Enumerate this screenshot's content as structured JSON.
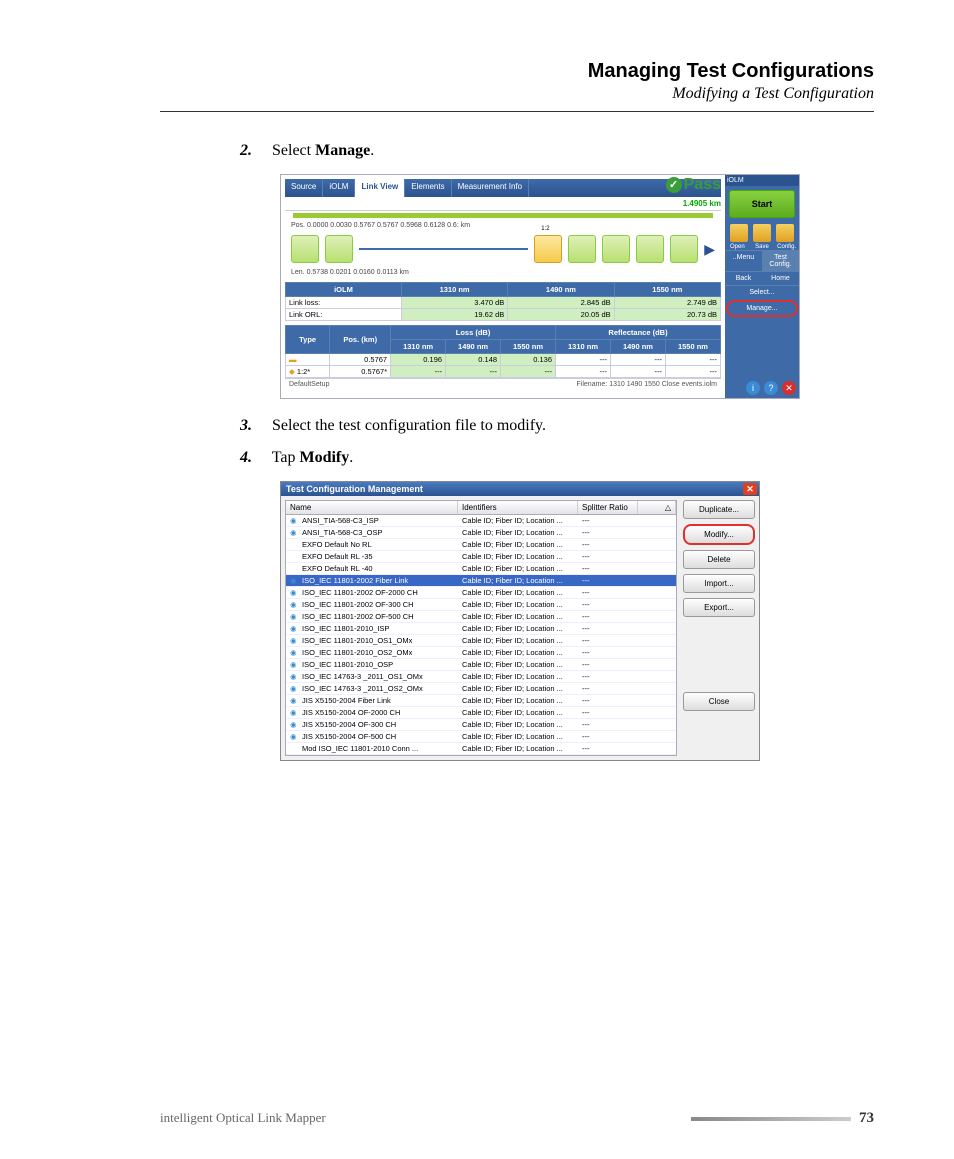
{
  "header": {
    "title": "Managing Test Configurations",
    "subtitle": "Modifying a Test Configuration"
  },
  "steps": {
    "s2": {
      "num": "2.",
      "pre": "Select ",
      "bold": "Manage",
      "post": "."
    },
    "s3": {
      "num": "3.",
      "text": "Select the test configuration file to modify."
    },
    "s4": {
      "num": "4.",
      "pre": "Tap ",
      "bold": "Modify",
      "post": "."
    }
  },
  "footer": {
    "product": "intelligent Optical Link Mapper",
    "page": "73"
  },
  "shot1": {
    "tabs": [
      "Source",
      "iOLM",
      "Link View",
      "Elements",
      "Measurement Info"
    ],
    "active_tab_idx": 2,
    "pass": "Pass",
    "distance": "1.4905 km",
    "pos_label": "Pos.",
    "positions": [
      "0.0000",
      "0.0030",
      "0.5767",
      "0.5767",
      "0.5968",
      "0.6128",
      "0.6:"
    ],
    "km": "km",
    "len_label": "Len.",
    "lengths": [
      "0.5738",
      "",
      "0.0201",
      "0.0160",
      "0.0113"
    ],
    "splitter_label": "1:2",
    "iolm_head": "iOLM",
    "wavelengths": [
      "1310 nm",
      "1490 nm",
      "1550 nm"
    ],
    "link_loss_label": "Link loss:",
    "link_loss": [
      "3.470 dB",
      "2.845 dB",
      "2.749 dB"
    ],
    "link_orl_label": "Link ORL:",
    "link_orl": [
      "19.62 dB",
      "20.05 dB",
      "20.73 dB"
    ],
    "tbl_headers": [
      "Type",
      "Pos. (km)",
      "Loss (dB)",
      "Reflectance (dB)"
    ],
    "tbl_wl": [
      "1310 nm",
      "1490 nm",
      "1550 nm",
      "1310 nm",
      "1490 nm",
      "1550 nm"
    ],
    "tbl_rows": [
      {
        "type": "",
        "pos": "0.5767",
        "l1": "0.196",
        "l2": "0.148",
        "l3": "0.136",
        "r1": "---",
        "r2": "---",
        "r3": "---"
      },
      {
        "type": "1:2*",
        "pos": "0.5767*",
        "l1": "---",
        "l2": "---",
        "l3": "---",
        "r1": "---",
        "r2": "---",
        "r3": "---"
      }
    ],
    "status_left": "DefaultSetup",
    "status_right": "Filename: 1310 1490 1550 Close events.iolm",
    "side": {
      "app": "iOLM",
      "start": "Start",
      "icons": [
        "Open",
        "Save",
        "Config."
      ],
      "menu_tab": [
        "..Menu",
        "Test Config."
      ],
      "back": "Back",
      "home": "Home",
      "select": "Select...",
      "manage": "Manage..."
    }
  },
  "shot2": {
    "title": "Test Configuration Management",
    "cols": [
      "Name",
      "Identifiers",
      "Splitter Ratio"
    ],
    "idtext": "Cable ID; Fiber ID; Location ...",
    "dash": "---",
    "rows": [
      {
        "n": "ANSI_TIA-568-C3_ISP",
        "g": true
      },
      {
        "n": "ANSI_TIA-568-C3_OSP",
        "g": true
      },
      {
        "n": "EXFO Default No RL",
        "g": false
      },
      {
        "n": "EXFO Default RL -35",
        "g": false
      },
      {
        "n": "EXFO Default RL -40",
        "g": false
      },
      {
        "n": "ISO_IEC 11801-2002 Fiber Link",
        "g": true,
        "sel": true
      },
      {
        "n": "ISO_IEC 11801-2002 OF-2000 CH",
        "g": true
      },
      {
        "n": "ISO_IEC 11801-2002 OF-300 CH",
        "g": true
      },
      {
        "n": "ISO_IEC 11801-2002 OF-500 CH",
        "g": true
      },
      {
        "n": "ISO_IEC 11801-2010_ISP",
        "g": true
      },
      {
        "n": "ISO_IEC 11801-2010_OS1_OMx",
        "g": true
      },
      {
        "n": "ISO_IEC 11801-2010_OS2_OMx",
        "g": true
      },
      {
        "n": "ISO_IEC 11801-2010_OSP",
        "g": true
      },
      {
        "n": "ISO_IEC 14763-3 _2011_OS1_OMx",
        "g": true
      },
      {
        "n": "ISO_IEC 14763-3 _2011_OS2_OMx",
        "g": true
      },
      {
        "n": "JIS X5150-2004 Fiber Link",
        "g": true
      },
      {
        "n": "JIS X5150-2004 OF-2000 CH",
        "g": true
      },
      {
        "n": "JIS X5150-2004 OF-300 CH",
        "g": true
      },
      {
        "n": "JIS X5150-2004 OF-500 CH",
        "g": true
      },
      {
        "n": "Mod ISO_IEC 11801-2010 Conn ...",
        "g": false
      }
    ],
    "btns": {
      "dup": "Duplicate...",
      "mod": "Modify...",
      "del": "Delete",
      "imp": "Import...",
      "exp": "Export...",
      "close": "Close"
    }
  }
}
